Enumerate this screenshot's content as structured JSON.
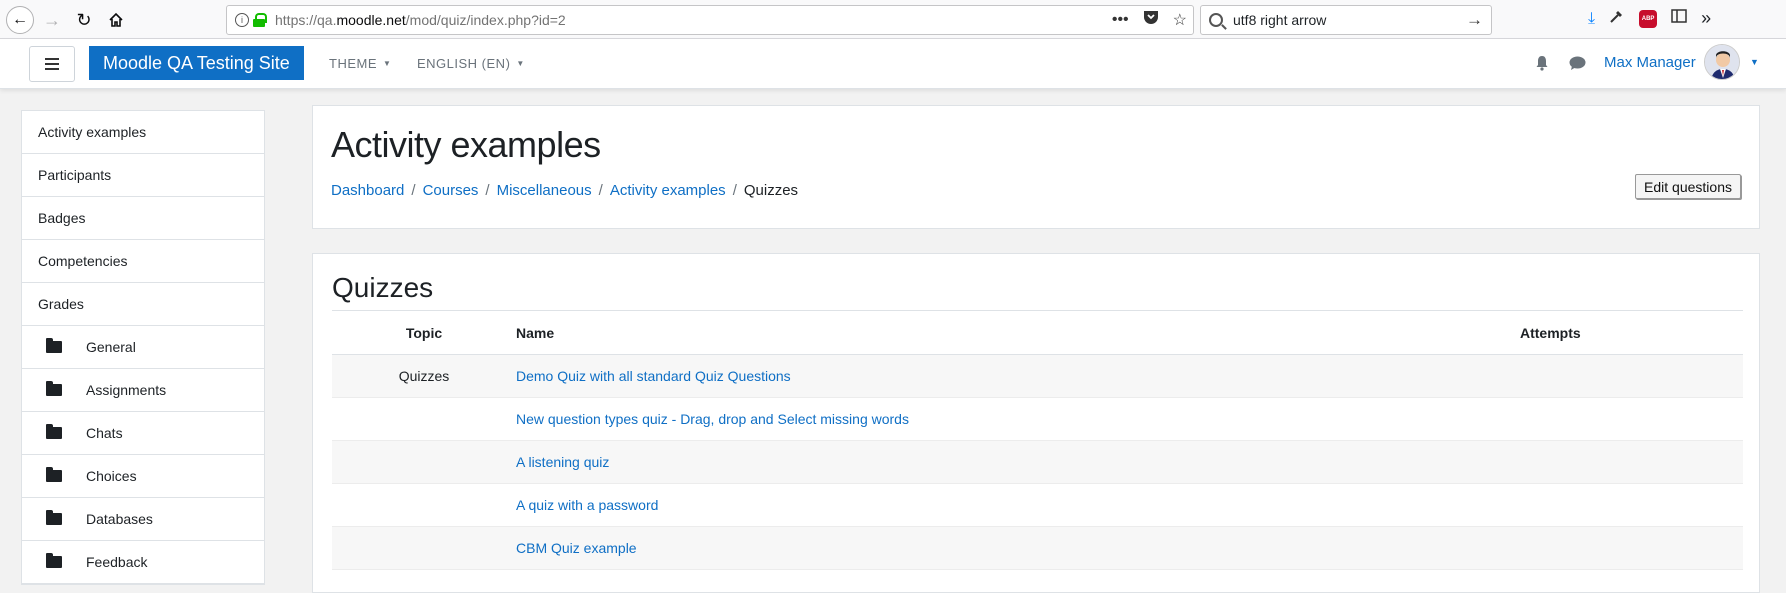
{
  "browser": {
    "url_prefix": "https://qa.",
    "url_host": "moodle.net",
    "url_path": "/mod/quiz/index.php?id=2",
    "search_value": "utf8 right arrow",
    "more_dots": "•••"
  },
  "navbar": {
    "site_name": "Moodle QA Testing Site",
    "theme_label": "THEME",
    "language_label": "ENGLISH (EN)",
    "user_name": "Max Manager"
  },
  "sidebar": {
    "items": [
      {
        "label": "Activity examples"
      },
      {
        "label": "Participants"
      },
      {
        "label": "Badges"
      },
      {
        "label": "Competencies"
      },
      {
        "label": "Grades"
      }
    ],
    "folders": [
      {
        "label": "General"
      },
      {
        "label": "Assignments"
      },
      {
        "label": "Chats"
      },
      {
        "label": "Choices"
      },
      {
        "label": "Databases"
      },
      {
        "label": "Feedback"
      }
    ]
  },
  "header": {
    "title": "Activity examples",
    "breadcrumb": [
      "Dashboard",
      "Courses",
      "Miscellaneous",
      "Activity examples"
    ],
    "breadcrumb_current": "Quizzes",
    "edit_button": "Edit questions"
  },
  "quizzes": {
    "title": "Quizzes",
    "columns": {
      "topic": "Topic",
      "name": "Name",
      "attempts": "Attempts"
    },
    "rows": [
      {
        "topic": "Quizzes",
        "name": "Demo Quiz with all standard Quiz Questions"
      },
      {
        "topic": "",
        "name": "New question types quiz - Drag, drop and Select missing words"
      },
      {
        "topic": "",
        "name": "A listening quiz"
      },
      {
        "topic": "",
        "name": "A quiz with a password"
      },
      {
        "topic": "",
        "name": "CBM Quiz example"
      }
    ]
  },
  "colors": {
    "brand": "#0f6fc5",
    "link": "#0f6fc5",
    "page_bg": "#f2f2f2"
  }
}
